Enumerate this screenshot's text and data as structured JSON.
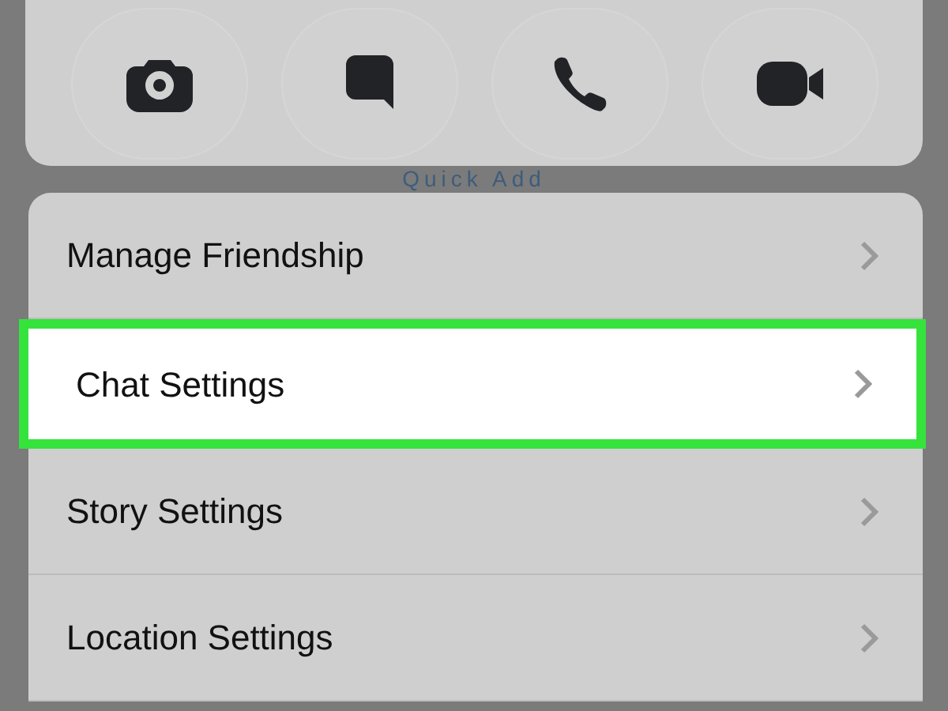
{
  "actions": [
    {
      "kind": "camera"
    },
    {
      "kind": "chat"
    },
    {
      "kind": "call"
    },
    {
      "kind": "video"
    }
  ],
  "section_label": "Quick Add",
  "menu": [
    {
      "label": "Manage Friendship",
      "selected": false
    },
    {
      "label": "Chat Settings",
      "selected": true
    },
    {
      "label": "Story Settings",
      "selected": false
    },
    {
      "label": "Location Settings",
      "selected": false
    }
  ]
}
